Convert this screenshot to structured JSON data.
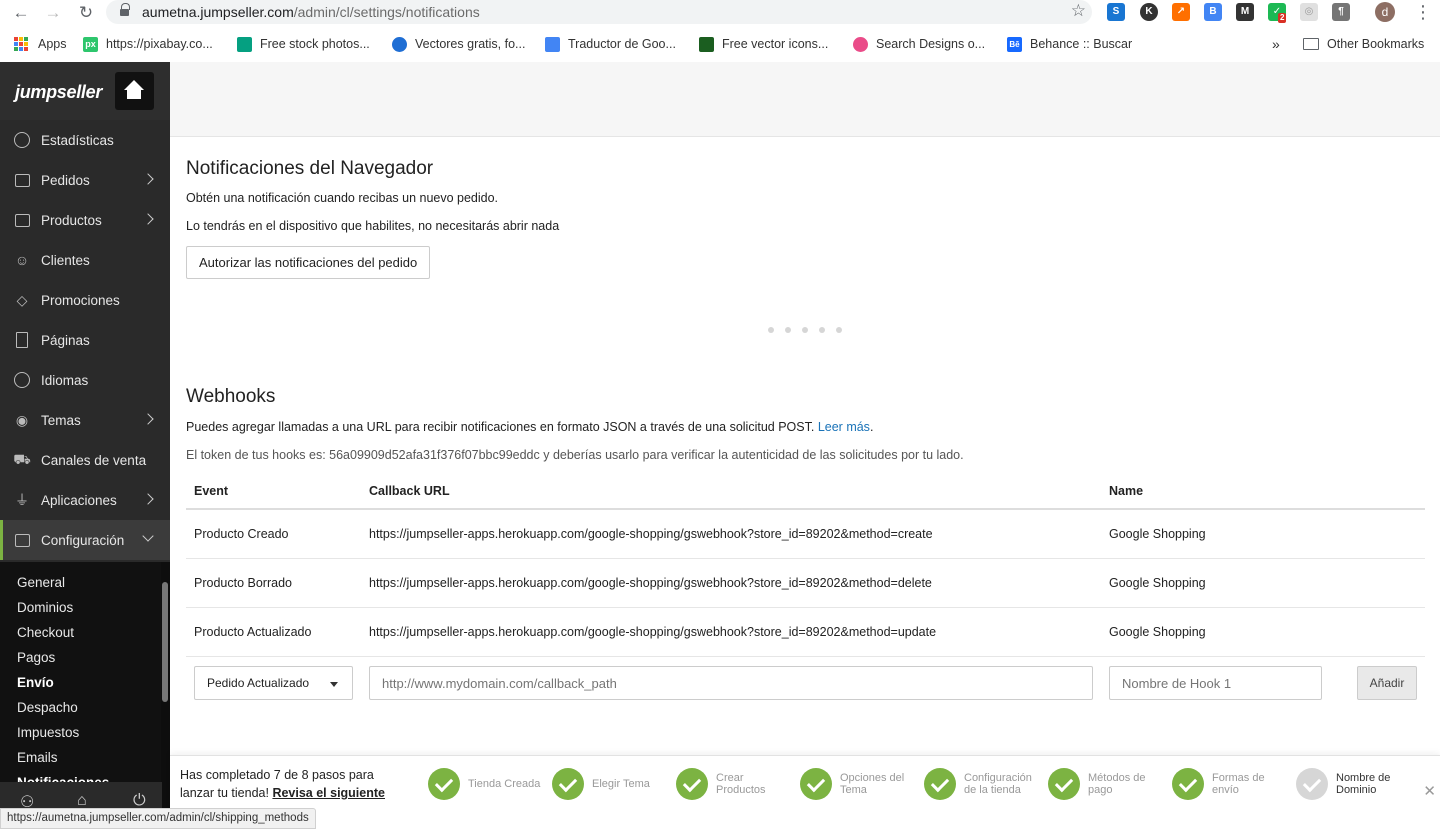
{
  "browser": {
    "url_host": "aumetna.jumpseller.com",
    "url_path": "/admin/cl/settings/notifications",
    "avatar_letter": "d",
    "ext_badge": "2"
  },
  "bookmarks": {
    "items": [
      {
        "label": "Apps"
      },
      {
        "label": "https://pixabay.co..."
      },
      {
        "label": "Free stock photos..."
      },
      {
        "label": "Vectores gratis, fo..."
      },
      {
        "label": "Traductor de Goo..."
      },
      {
        "label": "Free vector icons..."
      },
      {
        "label": "Search Designs o..."
      },
      {
        "label": "Behance :: Buscar"
      }
    ],
    "overflow": "»",
    "other": "Other Bookmarks"
  },
  "sidebar": {
    "logo": "jumpseller",
    "items": [
      {
        "label": "Estadísticas"
      },
      {
        "label": "Pedidos"
      },
      {
        "label": "Productos"
      },
      {
        "label": "Clientes"
      },
      {
        "label": "Promociones"
      },
      {
        "label": "Páginas"
      },
      {
        "label": "Idiomas"
      },
      {
        "label": "Temas"
      },
      {
        "label": "Canales de venta"
      },
      {
        "label": "Aplicaciones"
      },
      {
        "label": "Configuración"
      }
    ],
    "sub_items": [
      {
        "label": "General"
      },
      {
        "label": "Dominios"
      },
      {
        "label": "Checkout"
      },
      {
        "label": "Pagos"
      },
      {
        "label": "Envío"
      },
      {
        "label": "Despacho"
      },
      {
        "label": "Impuestos"
      },
      {
        "label": "Emails"
      },
      {
        "label": "Notificaciones"
      }
    ]
  },
  "browser_notifications": {
    "title": "Notificaciones del Navegador",
    "line1": "Obtén una notificación cuando recibas un nuevo pedido.",
    "line2": "Lo tendrás en el dispositivo que habilites, no necesitarás abrir nada",
    "button": "Autorizar las notificaciones del pedido"
  },
  "webhooks": {
    "title": "Webhooks",
    "desc": "Puedes agregar llamadas a una URL para recibir notificaciones en formato JSON a través de una solicitud POST.",
    "desc_link": "Leer más",
    "desc_end": ".",
    "token_text": "El token de tus hooks es: 56a09909d52afa31f376f07bbc99eddc y deberías usarlo para verificar la autenticidad de las solicitudes por tu lado.",
    "columns": {
      "event": "Event",
      "callback": "Callback URL",
      "name": "Name"
    },
    "rows": [
      {
        "event": "Producto Creado",
        "callback": "https://jumpseller-apps.herokuapp.com/google-shopping/gswebhook?store_id=89202&method=create",
        "name": "Google Shopping"
      },
      {
        "event": "Producto Borrado",
        "callback": "https://jumpseller-apps.herokuapp.com/google-shopping/gswebhook?store_id=89202&method=delete",
        "name": "Google Shopping"
      },
      {
        "event": "Producto Actualizado",
        "callback": "https://jumpseller-apps.herokuapp.com/google-shopping/gswebhook?store_id=89202&method=update",
        "name": "Google Shopping"
      }
    ],
    "form": {
      "event_selected": "Pedido Actualizado",
      "url_placeholder": "http://www.mydomain.com/callback_path",
      "name_placeholder": "Nombre de Hook 1",
      "add_button": "Añadir"
    }
  },
  "progress": {
    "text": "Has completado 7 de 8 pasos para lanzar tu tienda!",
    "link": "Revisa el siguiente paso »",
    "steps": [
      {
        "label": "Tienda Creada",
        "done": true
      },
      {
        "label": "Elegir Tema",
        "done": true
      },
      {
        "label": "Crear Productos",
        "done": true
      },
      {
        "label": "Opciones del Tema",
        "done": true
      },
      {
        "label": "Configuración de la tienda",
        "done": true
      },
      {
        "label": "Métodos de pago",
        "done": true
      },
      {
        "label": "Formas de envío",
        "done": true
      },
      {
        "label": "Nombre de Dominio",
        "done": false
      }
    ],
    "close": "✕"
  },
  "status_url": "https://aumetna.jumpseller.com/admin/cl/shipping_methods",
  "colors": {
    "accent": "#7cb342",
    "link": "#1a73b8",
    "sidebar": "#2a2a2a"
  }
}
